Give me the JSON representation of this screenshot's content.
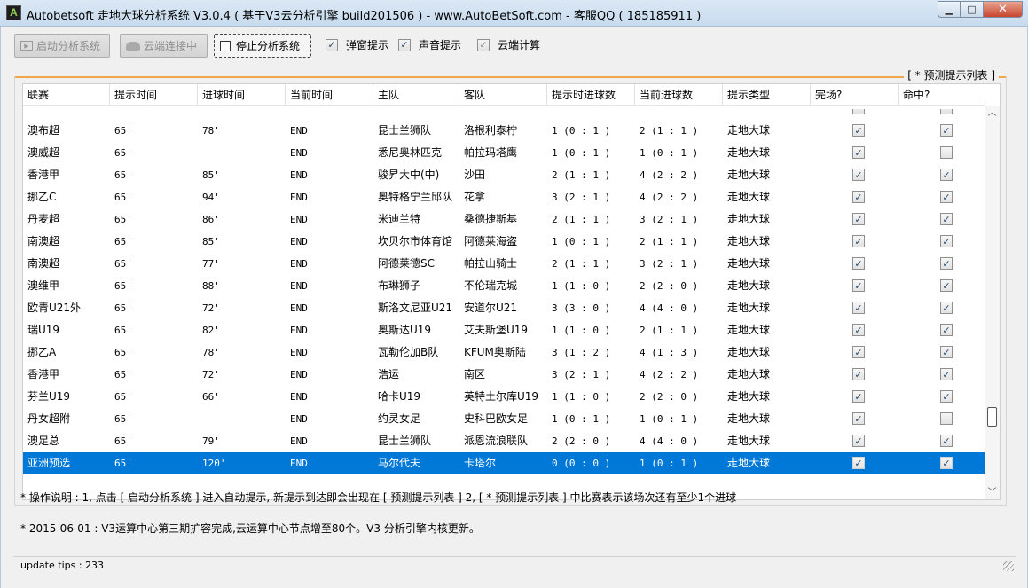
{
  "window": {
    "title": "Autobetsoft 走地大球分析系统 V3.0.4 ( 基于V3云分析引擎 build201506 ) - www.AutoBetSoft.com - 客服QQ ( 185185911 )",
    "icon_letter": "A",
    "min_glyph": "▁",
    "max_glyph": "□",
    "close_glyph": "✕"
  },
  "toolbar": {
    "start_label": "启动分析系统",
    "cloud_label": "云端连接中",
    "stop_label": "停止分析系统",
    "popup_label": "弹窗提示",
    "sound_label": "声音提示",
    "cloud_calc_label": "云端计算",
    "check_glyph": "✓"
  },
  "group_title": "[ * 预测提示列表 ]",
  "columns": [
    "联赛",
    "提示时间",
    "进球时间",
    "当前时间",
    "主队",
    "客队",
    "提示时进球数",
    "当前进球数",
    "提示类型",
    "完场?",
    "命中?"
  ],
  "rows": [
    {
      "league": "澳布超",
      "tip": "65'",
      "goal": "78'",
      "now": "END",
      "home": "昆士兰狮队",
      "away": "洛根利泰柠",
      "tip_score": "1 (0 : 1 )",
      "cur_score": "2 (1 : 1 )",
      "type": "走地大球",
      "finished": true,
      "hit": true
    },
    {
      "league": "澳威超",
      "tip": "65'",
      "goal": "",
      "now": "END",
      "home": "悉尼奥林匹克",
      "away": "帕拉玛塔鹰",
      "tip_score": "1 (0 : 1 )",
      "cur_score": "1 (0 : 1 )",
      "type": "走地大球",
      "finished": true,
      "hit": false
    },
    {
      "league": "香港甲",
      "tip": "65'",
      "goal": "85'",
      "now": "END",
      "home": "骏昇大中(中)",
      "away": "沙田",
      "tip_score": "2 (1 : 1 )",
      "cur_score": "4 (2 : 2 )",
      "type": "走地大球",
      "finished": true,
      "hit": true
    },
    {
      "league": "挪乙C",
      "tip": "65'",
      "goal": "94'",
      "now": "END",
      "home": "奥特格宁兰邱队",
      "away": "花拿",
      "tip_score": "3 (2 : 1 )",
      "cur_score": "4 (2 : 2 )",
      "type": "走地大球",
      "finished": true,
      "hit": true
    },
    {
      "league": "丹麦超",
      "tip": "65'",
      "goal": "86'",
      "now": "END",
      "home": "米迪兰特",
      "away": "桑德捷斯基",
      "tip_score": "2 (1 : 1 )",
      "cur_score": "3 (2 : 1 )",
      "type": "走地大球",
      "finished": true,
      "hit": true
    },
    {
      "league": "南澳超",
      "tip": "65'",
      "goal": "85'",
      "now": "END",
      "home": "坎贝尔市体育馆",
      "away": "阿德莱海盗",
      "tip_score": "1 (0 : 1 )",
      "cur_score": "2 (1 : 1 )",
      "type": "走地大球",
      "finished": true,
      "hit": true
    },
    {
      "league": "南澳超",
      "tip": "65'",
      "goal": "77'",
      "now": "END",
      "home": "阿德莱德SC",
      "away": "帕拉山骑士",
      "tip_score": "2 (1 : 1 )",
      "cur_score": "3 (2 : 1 )",
      "type": "走地大球",
      "finished": true,
      "hit": true
    },
    {
      "league": "澳维甲",
      "tip": "65'",
      "goal": "88'",
      "now": "END",
      "home": "布琳狮子",
      "away": "不伦瑞克城",
      "tip_score": "1 (1 : 0 )",
      "cur_score": "2 (2 : 0 )",
      "type": "走地大球",
      "finished": true,
      "hit": true
    },
    {
      "league": "欧青U21外",
      "tip": "65'",
      "goal": "72'",
      "now": "END",
      "home": "斯洛文尼亚U21",
      "away": "安道尔U21",
      "tip_score": "3 (3 : 0 )",
      "cur_score": "4 (4 : 0 )",
      "type": "走地大球",
      "finished": true,
      "hit": true
    },
    {
      "league": "瑞U19",
      "tip": "65'",
      "goal": "82'",
      "now": "END",
      "home": "奥斯达U19",
      "away": "艾夫斯堡U19",
      "tip_score": "1 (1 : 0 )",
      "cur_score": "2 (1 : 1 )",
      "type": "走地大球",
      "finished": true,
      "hit": true
    },
    {
      "league": "挪乙A",
      "tip": "65'",
      "goal": "78'",
      "now": "END",
      "home": "瓦勒伦加B队",
      "away": "KFUM奥斯陆",
      "tip_score": "3 (1 : 2 )",
      "cur_score": "4 (1 : 3 )",
      "type": "走地大球",
      "finished": true,
      "hit": true
    },
    {
      "league": "香港甲",
      "tip": "65'",
      "goal": "72'",
      "now": "END",
      "home": "浩运",
      "away": "南区",
      "tip_score": "3 (2 : 1 )",
      "cur_score": "4 (2 : 2 )",
      "type": "走地大球",
      "finished": true,
      "hit": true
    },
    {
      "league": "芬兰U19",
      "tip": "65'",
      "goal": "66'",
      "now": "END",
      "home": "哈卡U19",
      "away": "英特土尔库U19",
      "tip_score": "1 (1 : 0 )",
      "cur_score": "2 (2 : 0 )",
      "type": "走地大球",
      "finished": true,
      "hit": true
    },
    {
      "league": "丹女超附",
      "tip": "65'",
      "goal": "",
      "now": "END",
      "home": "约灵女足",
      "away": "史科巴欧女足",
      "tip_score": "1 (0 : 1 )",
      "cur_score": "1 (0 : 1 )",
      "type": "走地大球",
      "finished": true,
      "hit": false
    },
    {
      "league": "澳足总",
      "tip": "65'",
      "goal": "79'",
      "now": "END",
      "home": "昆士兰狮队",
      "away": "派恩流浪联队",
      "tip_score": "2 (2 : 0 )",
      "cur_score": "4 (4 : 0 )",
      "type": "走地大球",
      "finished": true,
      "hit": true
    },
    {
      "league": "亚洲预选",
      "tip": "65'",
      "goal": "120'",
      "now": "END",
      "home": "马尔代夫",
      "away": "卡塔尔",
      "tip_score": "0 (0 : 0 )",
      "cur_score": "1 (0 : 1 )",
      "type": "走地大球",
      "finished": true,
      "hit": true
    }
  ],
  "scroll": {
    "up_glyph": "︿",
    "down_glyph": "﹀"
  },
  "info": {
    "line1": "* 操作说明 : 1, 点击 [ 启动分析系统 ] 进入自动提示, 新提示到达即会出现在 [ 预测提示列表 ] 2, [ * 预测提示列表 ] 中比赛表示该场次还有至少1个进球",
    "line2": "* 2015-06-01 :  V3运算中心第三期扩容完成,云运算中心节点增至80个。V3 分析引擎内核更新。"
  },
  "status": {
    "text": "update tips : 233"
  }
}
